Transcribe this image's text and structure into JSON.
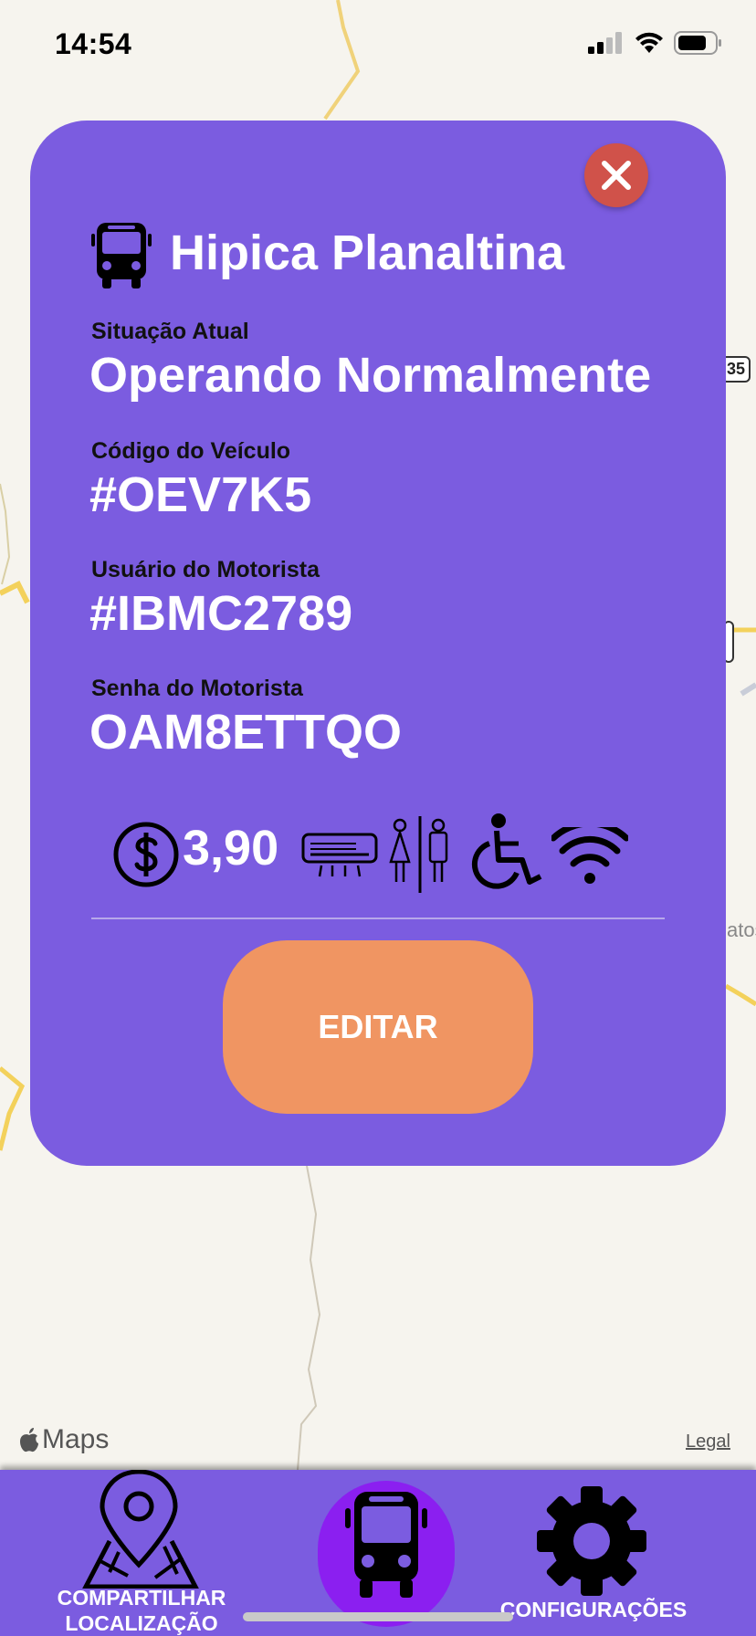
{
  "status_bar": {
    "time": "14:54"
  },
  "card": {
    "title": "Hipica Planaltina",
    "fields": [
      {
        "label": "Situação Atual",
        "value": "Operando Normalmente"
      },
      {
        "label": "Código do Veículo",
        "value": "#OEV7K5"
      },
      {
        "label": "Usuário do Motorista",
        "value": "#IBMC2789"
      },
      {
        "label": "Senha do Motorista",
        "value": "OAM8ETTQO"
      }
    ],
    "price": "3,90",
    "features": [
      "dollar-icon",
      "air-conditioning-icon",
      "restroom-icon",
      "wheelchair-icon",
      "wifi-icon"
    ],
    "edit_label": "EDITAR"
  },
  "map": {
    "attribution": "Maps",
    "legal": "Legal",
    "road_badge": "35",
    "place_fragment": "atos"
  },
  "tab_bar": {
    "share_label_line1": "COMPARTILHAR",
    "share_label_line2": "LOCALIZAÇÃO",
    "config_label": "CONFIGURAÇÕES"
  },
  "colors": {
    "card": "#7b5ce0",
    "edit_button": "#f09562",
    "close_button": "#d0524a",
    "active_tab": "#8b1ff0"
  }
}
